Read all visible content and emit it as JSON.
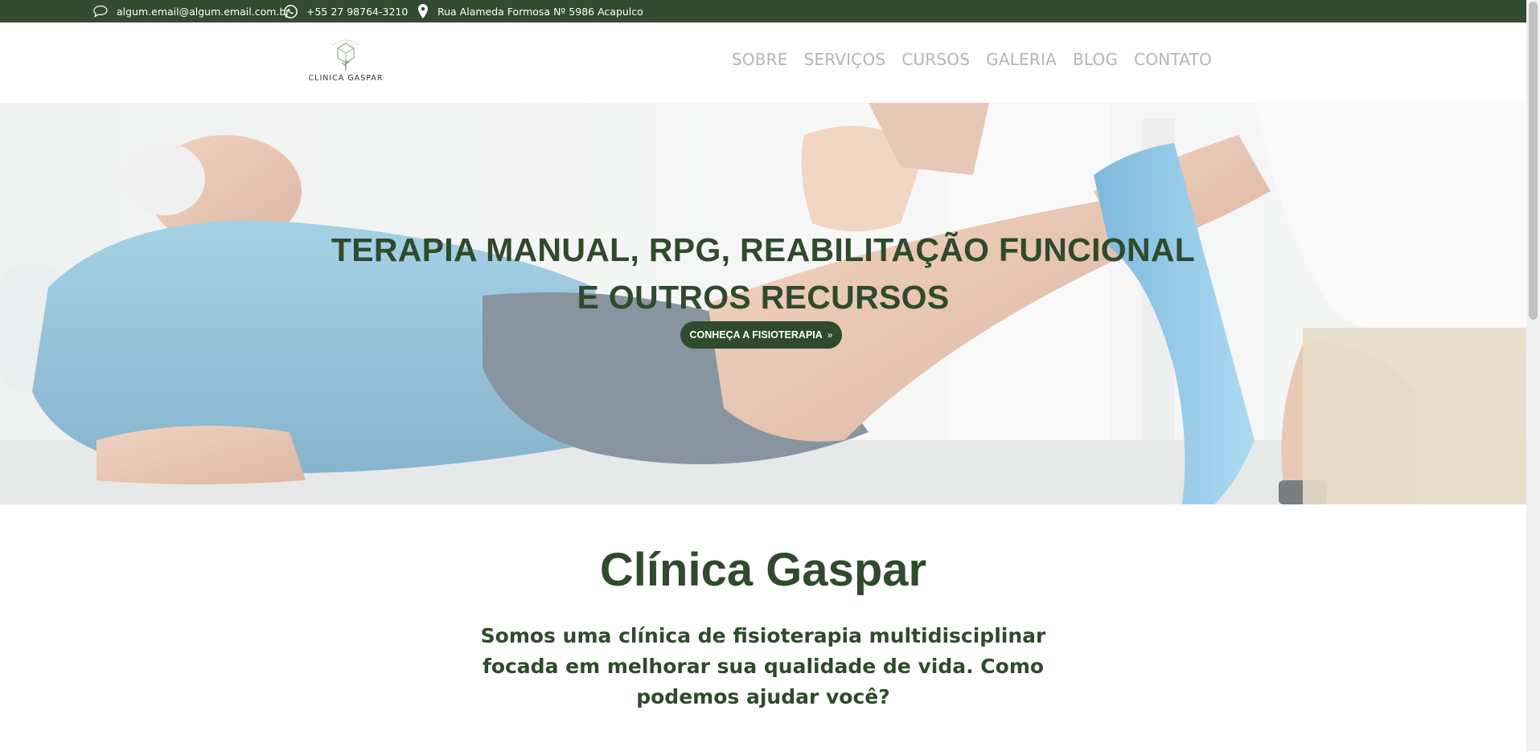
{
  "topbar": {
    "email": "algum.email@algum.email.com.br",
    "phone": "+55 27 98764-3210",
    "address": "Rua Alameda Formosa Nº 5986 Acapulco"
  },
  "header": {
    "brand": "CLINICA GASPAR",
    "nav": [
      "SOBRE",
      "SERVIÇOS",
      "CURSOS",
      "GALERIA",
      "BLOG",
      "CONTATO"
    ]
  },
  "hero": {
    "title_line1": "TERAPIA MANUAL, RPG, REABILITAÇÃO FUNCIONAL",
    "title_line2": "E OUTROS RECURSOS",
    "cta_label": "CONHEÇA A FISIOTERAPIA"
  },
  "about": {
    "title": "Clínica Gaspar",
    "text": "Somos uma clínica de fisioterapia multidisciplinar focada em melhorar sua qualidade de vida. Como podemos ajudar você?"
  },
  "colors": {
    "brand_green": "#334b30",
    "text_green": "#2f4a2c",
    "nav_gray": "#b5b5b5",
    "band_blue": "#4fa6d9"
  },
  "icons": [
    "speech-bubble-icon",
    "whatsapp-icon",
    "map-pin-icon",
    "double-chevron-right-icon",
    "tree-logo-icon"
  ]
}
